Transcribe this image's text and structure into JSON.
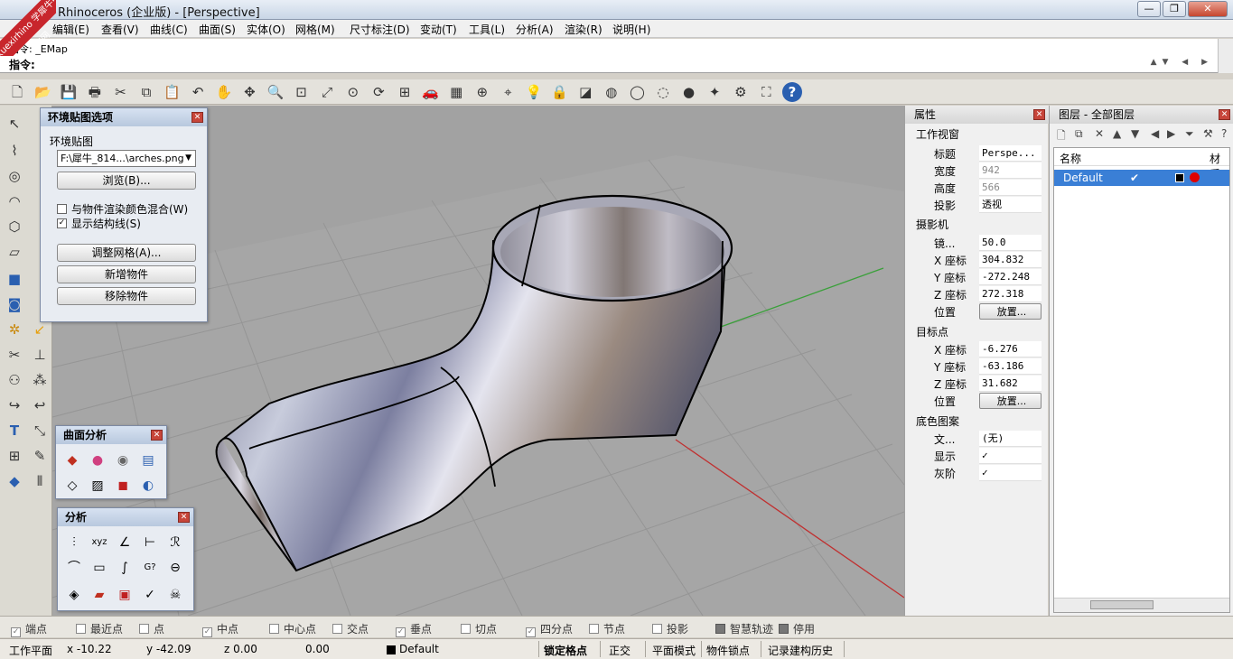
{
  "window": {
    "title": "Rhinoceros (企业版) - [Perspective]",
    "watermark": "xuexirhino 学犀牛中文网",
    "buttons": {
      "minimize": "—",
      "maximize": "❐",
      "close": "✕"
    }
  },
  "menu": [
    "编辑(E)",
    "查看(V)",
    "曲线(C)",
    "曲面(S)",
    "实体(O)",
    "网格(M)",
    "尺寸标注(D)",
    "变动(T)",
    "工具(L)",
    "分析(A)",
    "渲染(R)",
    "说明(H)"
  ],
  "command": {
    "history": "指令: _EMap",
    "prompt": "指令:",
    "input_value": ""
  },
  "toolbar_icons": [
    "new-file-icon",
    "open-file-icon",
    "save-icon",
    "print-icon",
    "cut-icon",
    "copy-icon",
    "paste-icon",
    "undo-icon",
    "pan-hand-icon",
    "rotate-view-icon",
    "zoom-icon",
    "zoom-window-icon",
    "zoom-extents-icon",
    "zoom-selected-icon",
    "rotate-camera-icon",
    "four-viewports-icon",
    "car-icon",
    "grid-icon",
    "snap-icon",
    "osnap-icon",
    "light-bulb-icon",
    "lock-icon",
    "layer-icon",
    "color-wheel-icon",
    "sphere-wire-icon",
    "sphere-mesh-icon",
    "sphere-render-icon",
    "render-icon",
    "gear-icon",
    "selection-icon",
    "help-icon"
  ],
  "viewport": {
    "name": "Perspective"
  },
  "env_panel": {
    "title": "环境贴图选项",
    "group_label": "环境贴图",
    "file_value": "F:\\犀牛_814...\\arches.png",
    "browse_button": "浏览(B)...",
    "blend_label": "与物件渲染颜色混合(W)",
    "blend_checked": false,
    "show_structure_label": "显示结构线(S)",
    "show_structure_checked": true,
    "adjust_mesh_button": "调整网格(A)...",
    "add_object_button": "新增物件",
    "remove_object_button": "移除物件"
  },
  "surface_analysis_panel": {
    "title": "曲面分析",
    "icons": [
      "curvature-analysis-icon",
      "draft-angle-icon",
      "environment-map-icon",
      "zebra-icon",
      "edge-analysis-icon",
      "thickness-icon",
      "draft-icon",
      "dihedral-icon"
    ]
  },
  "analysis_panel": {
    "title": "分析",
    "icons": [
      "distance-icon",
      "xyz-point-icon",
      "angle-icon",
      "length-icon",
      "radius-icon",
      "curvature-graph-icon",
      "bounding-box-icon",
      "curve-continuity-icon",
      "geometric-continuity-icon",
      "deviation-icon",
      "surface-diagnosis-icon",
      "color-zebra-icon",
      "cube-check-icon",
      "check-icon",
      "skull-icon"
    ]
  },
  "properties": {
    "title": "属性",
    "viewport_section": "工作视窗",
    "rows_viewport": [
      {
        "key": "标题",
        "value": "Perspe...",
        "gray": false
      },
      {
        "key": "宽度",
        "value": "942",
        "gray": true
      },
      {
        "key": "高度",
        "value": "566",
        "gray": true
      },
      {
        "key": "投影",
        "value": "透视",
        "gray": false
      }
    ],
    "camera_section": "摄影机",
    "rows_camera": [
      {
        "key": "镜...",
        "value": "50.0"
      },
      {
        "key": "X 座标",
        "value": "304.832"
      },
      {
        "key": "Y 座标",
        "value": "-272.248"
      },
      {
        "key": "Z 座标",
        "value": "272.318"
      },
      {
        "key": "位置",
        "value": "放置..."
      }
    ],
    "target_section": "目标点",
    "rows_target": [
      {
        "key": "X 座标",
        "value": "-6.276"
      },
      {
        "key": "Y 座标",
        "value": "-63.186"
      },
      {
        "key": "Z 座标",
        "value": "31.682"
      },
      {
        "key": "位置",
        "value": "放置..."
      }
    ],
    "wallpaper_section": "底色图案",
    "rows_wallpaper": [
      {
        "key": "文...",
        "value": "(无)"
      },
      {
        "key": "显示",
        "value": "✓"
      },
      {
        "key": "灰阶",
        "value": "✓"
      }
    ]
  },
  "layers": {
    "title": "图层 - 全部图层",
    "col_name": "名称",
    "col_material": "材质",
    "rows": [
      {
        "name": "Default",
        "current": "✔",
        "color": "#000000",
        "material_color": "#e00000"
      }
    ]
  },
  "osnap": [
    {
      "label": "端点",
      "checked": true
    },
    {
      "label": "最近点",
      "checked": false
    },
    {
      "label": "点",
      "checked": false
    },
    {
      "label": "中点",
      "checked": true
    },
    {
      "label": "中心点",
      "checked": false
    },
    {
      "label": "交点",
      "checked": false
    },
    {
      "label": "垂点",
      "checked": true
    },
    {
      "label": "切点",
      "checked": false
    },
    {
      "label": "四分点",
      "checked": true
    },
    {
      "label": "节点",
      "checked": false
    },
    {
      "label": "投影",
      "checked": false
    },
    {
      "label": "智慧轨迹",
      "checked": false,
      "toggle": true
    },
    {
      "label": "停用",
      "checked": false,
      "toggle": true
    }
  ],
  "status": {
    "plane": "工作平面",
    "x": "x -10.22",
    "y": "y -42.09",
    "z": "z 0.00",
    "d": "0.00",
    "layer": "Default",
    "grid_snap": "锁定格点",
    "ortho": "正交",
    "planar": "平面模式",
    "osnap": "物件锁点",
    "history": "记录建构历史"
  }
}
